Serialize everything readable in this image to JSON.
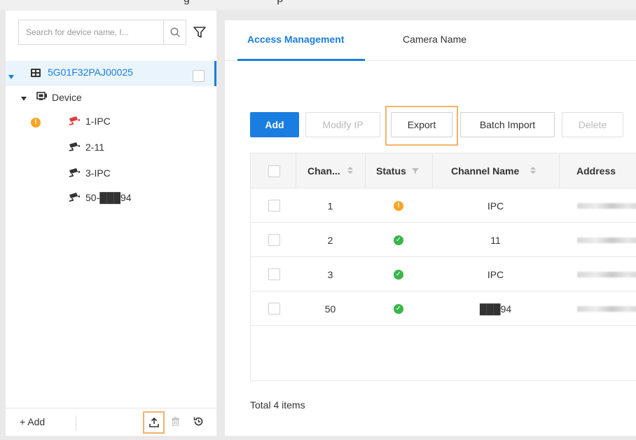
{
  "window_title_fragment": "g ... p",
  "sidebar": {
    "search_placeholder": "Search for device name, I...",
    "root": {
      "label": "5G01F32PAJ00025"
    },
    "group": {
      "label": "Device"
    },
    "devices": [
      {
        "label": "1-IPC",
        "status": "warning"
      },
      {
        "label": "2-11",
        "status": "normal"
      },
      {
        "label": "3-IPC",
        "status": "normal"
      },
      {
        "label": "50-███94",
        "status": "normal"
      }
    ],
    "footer": {
      "add_label": "+ Add"
    }
  },
  "tabs": [
    {
      "label": "Access Management",
      "active": true
    },
    {
      "label": "Camera Name",
      "active": false
    }
  ],
  "toolbar": {
    "add": "Add",
    "modify_ip": "Modify IP",
    "export": "Export",
    "batch_import": "Batch Import",
    "delete": "Delete"
  },
  "table": {
    "headers": {
      "channel": "Chan...",
      "status": "Status",
      "channel_name": "Channel Name",
      "address": "Address"
    },
    "rows": [
      {
        "channel": "1",
        "status": "warning",
        "channel_name": "IPC"
      },
      {
        "channel": "2",
        "status": "online",
        "channel_name": "11"
      },
      {
        "channel": "3",
        "status": "online",
        "channel_name": "IPC"
      },
      {
        "channel": "50",
        "status": "online",
        "channel_name": "███94"
      }
    ],
    "total_label": "Total 4 items"
  },
  "colors": {
    "accent": "#1a7ee0",
    "highlight_outline": "#f5b26b",
    "warning": "#f5a623",
    "online": "#3ab54a",
    "alarm_camera": "#e23b3b"
  },
  "icons": {
    "search": "search-icon",
    "filter": "filter-icon",
    "nvr": "nvr-icon",
    "device_group": "device-group-icon",
    "camera": "camera-icon",
    "export": "export-icon",
    "delete": "trash-icon",
    "refresh": "refresh-icon"
  }
}
